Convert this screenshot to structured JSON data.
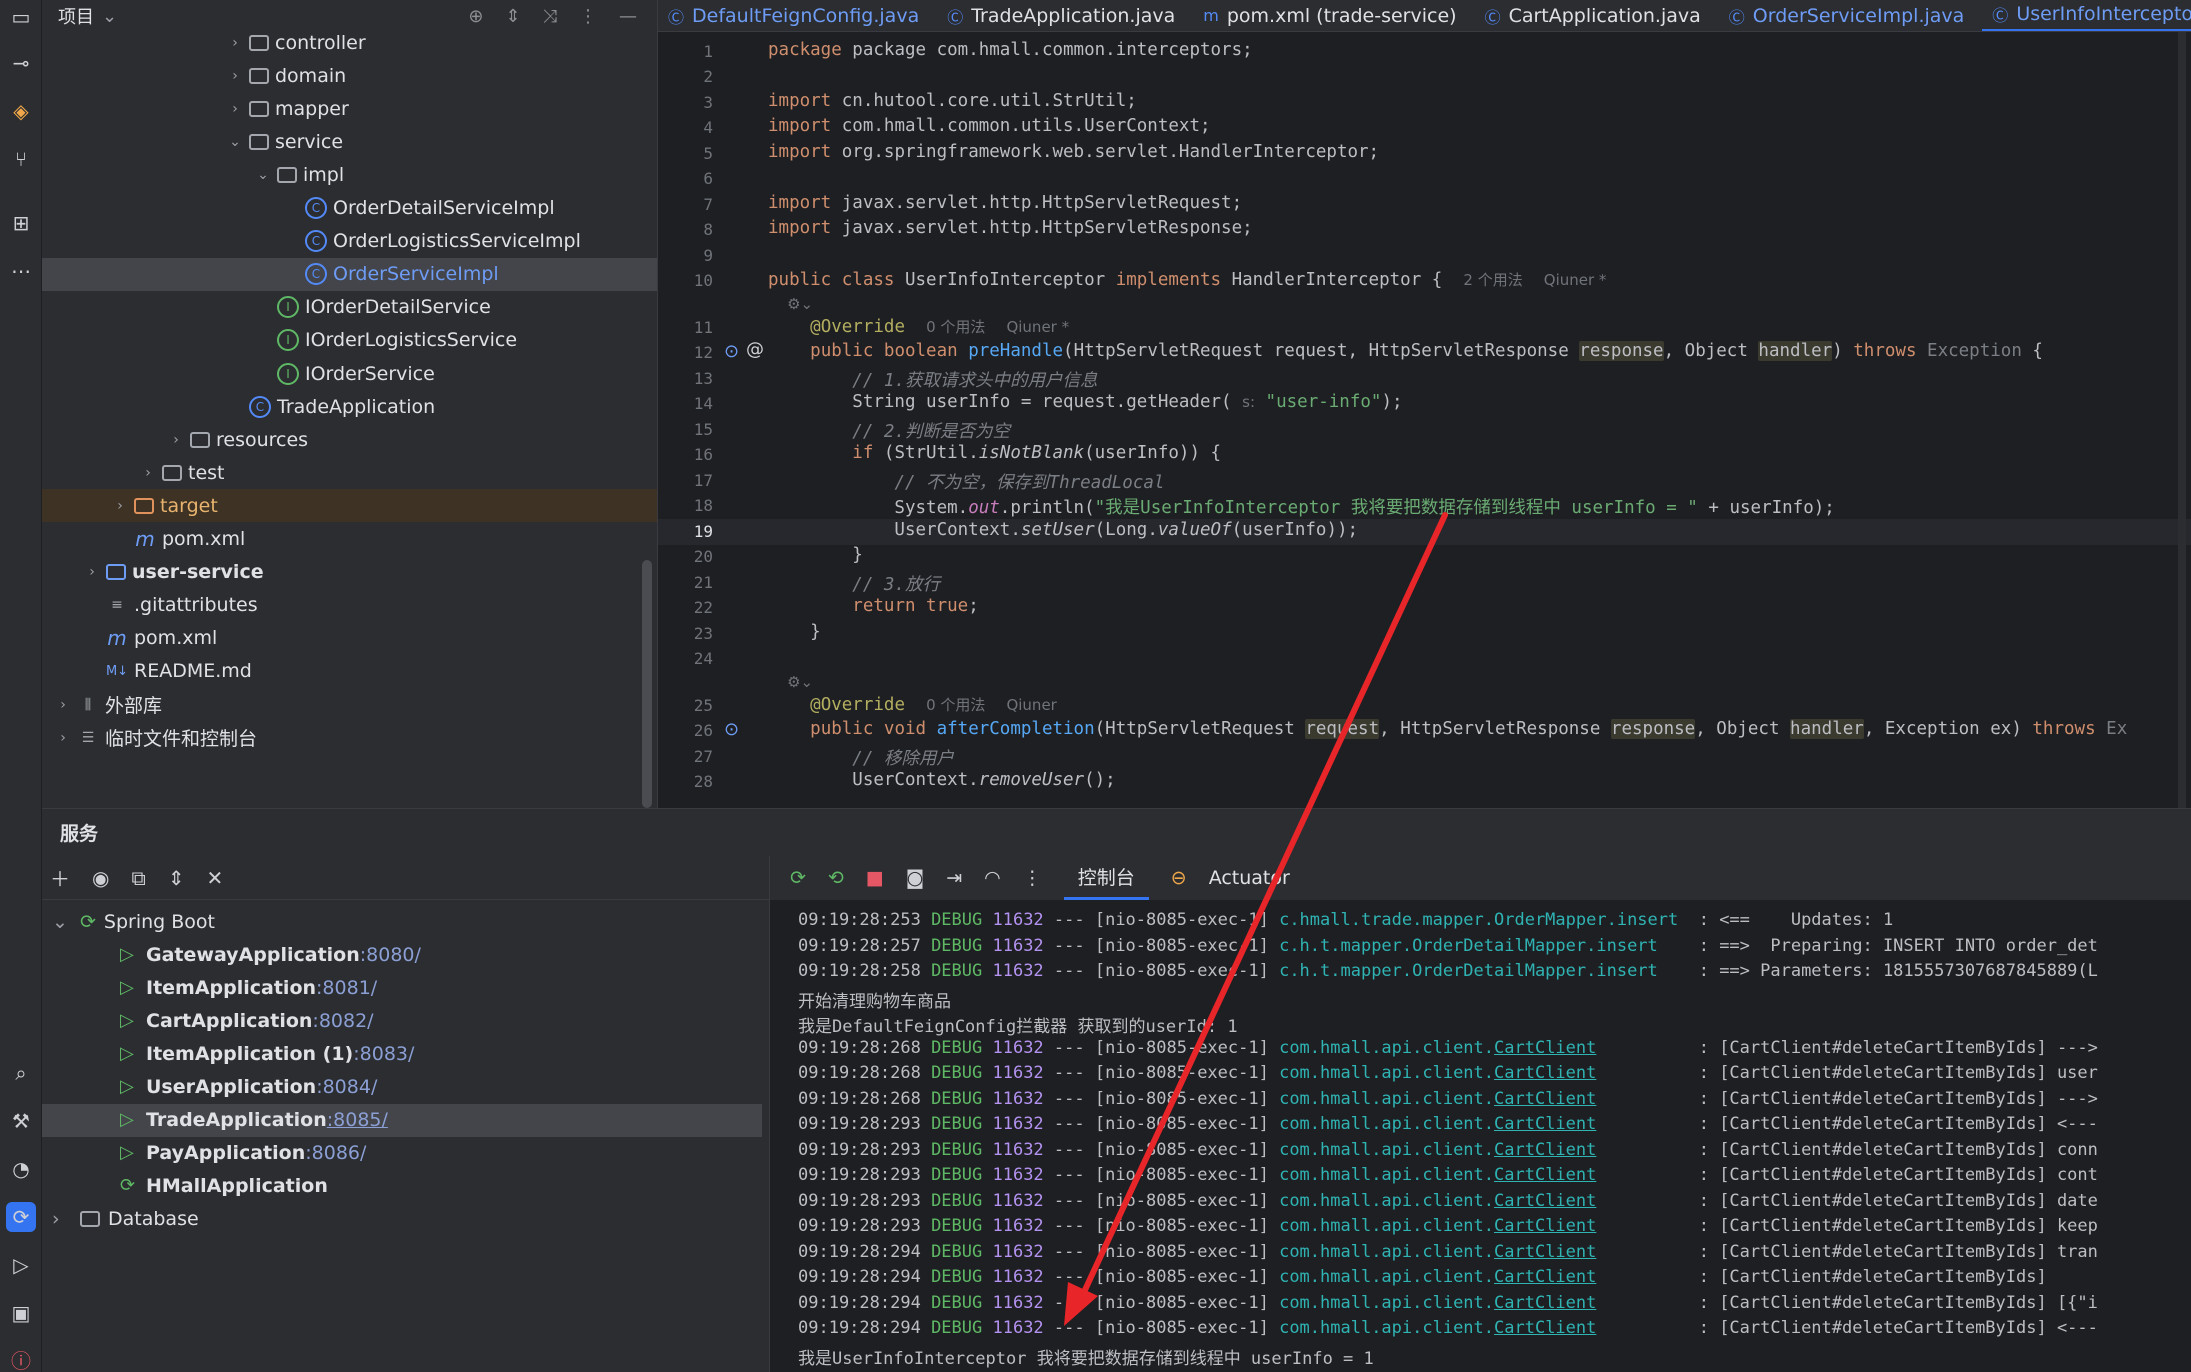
{
  "project": {
    "title": "项目",
    "tree": [
      {
        "label": "controller",
        "type": "folder",
        "arrow": "›",
        "indent": 1
      },
      {
        "label": "domain",
        "type": "folder",
        "arrow": "›",
        "indent": 1
      },
      {
        "label": "mapper",
        "type": "folder",
        "arrow": "›",
        "indent": 1
      },
      {
        "label": "service",
        "type": "folder",
        "arrow": "⌄",
        "indent": 1
      },
      {
        "label": "impl",
        "type": "folder",
        "arrow": "⌄",
        "indent": 2
      },
      {
        "label": "OrderDetailServiceImpl",
        "type": "class",
        "arrow": "",
        "indent": 3
      },
      {
        "label": "OrderLogisticsServiceImpl",
        "type": "class",
        "arrow": "",
        "indent": 3
      },
      {
        "label": "OrderServiceImpl",
        "type": "class",
        "arrow": "",
        "indent": 3,
        "selected": true
      },
      {
        "label": "IOrderDetailService",
        "type": "interface",
        "arrow": "",
        "indent": 2
      },
      {
        "label": "IOrderLogisticsService",
        "type": "interface",
        "arrow": "",
        "indent": 2
      },
      {
        "label": "IOrderService",
        "type": "interface",
        "arrow": "",
        "indent": 2
      },
      {
        "label": "TradeApplication",
        "type": "app",
        "arrow": "",
        "indent": 1
      },
      {
        "label": "resources",
        "type": "folder",
        "arrow": "›",
        "indent": 0
      },
      {
        "label": "test",
        "type": "folder",
        "arrow": "›",
        "indent": -1
      },
      {
        "label": "target",
        "type": "folder-orange",
        "arrow": "›",
        "indent": -2,
        "highlight": true
      },
      {
        "label": "pom.xml",
        "type": "maven",
        "arrow": "",
        "indent": -2
      },
      {
        "label": "user-service",
        "type": "module",
        "arrow": "›",
        "indent": -3,
        "bold": true
      },
      {
        "label": ".gitattributes",
        "type": "file",
        "arrow": "",
        "indent": -3
      },
      {
        "label": "pom.xml",
        "type": "maven",
        "arrow": "",
        "indent": -3
      },
      {
        "label": "README.md",
        "type": "md",
        "arrow": "",
        "indent": -3
      },
      {
        "label": "外部库",
        "type": "lib",
        "arrow": "›",
        "indent": -4
      },
      {
        "label": "临时文件和控制台",
        "type": "scratch",
        "arrow": "›",
        "indent": -4
      }
    ]
  },
  "tabs": [
    {
      "label": "DefaultFeignConfig.java",
      "style": "blue"
    },
    {
      "label": "TradeApplication.java",
      "style": "normal"
    },
    {
      "label": "pom.xml (trade-service)",
      "style": "normal"
    },
    {
      "label": "CartApplication.java",
      "style": "normal"
    },
    {
      "label": "OrderServiceImpl.java",
      "style": "blue"
    },
    {
      "label": "UserInfoInterceptor.java",
      "style": "active"
    }
  ],
  "gutter_numbers": [
    "1",
    "2",
    "3",
    "4",
    "5",
    "6",
    "7",
    "8",
    "9",
    "10",
    "11",
    "12",
    "13",
    "14",
    "15",
    "16",
    "17",
    "18",
    "19",
    "20",
    "21",
    "22",
    "23",
    "24",
    "25",
    "26",
    "27",
    "28"
  ],
  "code": {
    "pkg": "package com.hmall.common.interceptors;",
    "imp1": "cn.hutool.core.util.StrUtil;",
    "imp2": "com.hmall.common.utils.UserContext;",
    "imp3": "org.springframework.web.servlet.HandlerInterceptor;",
    "imp4": "javax.servlet.http.HttpServletRequest;",
    "imp5": "javax.servlet.http.HttpServletResponse;",
    "cls_hint": "2 个用法",
    "author": "Qiuner *",
    "author2": "Qiuner",
    "override": "@Override",
    "usage0": "0 个用法",
    "comment1": "// 1.获取请求头中的用户信息",
    "getheader_str": "\"user-info\"",
    "comment2": "// 2.判断是否为空",
    "comment3": "// 不为空，保存到ThreadLocal",
    "println_str": "\"我是UserInfoInterceptor 我将要把数据存储到线程中 userInfo = \"",
    "comment4": "// 3.放行",
    "comment5": "// 移除用户"
  },
  "services": {
    "title": "服务",
    "root": "Spring Boot",
    "apps": [
      {
        "name": "GatewayApplication",
        "port": ":8080/"
      },
      {
        "name": "ItemApplication",
        "port": ":8081/"
      },
      {
        "name": "CartApplication",
        "port": ":8082/"
      },
      {
        "name": "ItemApplication (1)",
        "port": ":8083/"
      },
      {
        "name": "UserApplication",
        "port": ":8084/"
      },
      {
        "name": "TradeApplication",
        "port": ":8085/",
        "selected": true
      },
      {
        "name": "PayApplication",
        "port": ":8086/"
      },
      {
        "name": "HMallApplication",
        "port": ""
      }
    ],
    "database": "Database"
  },
  "console": {
    "tab_console": "控制台",
    "tab_actuator": "Actuator",
    "lines": [
      {
        "t": "09:19:28:253",
        "lvl": "DEBUG",
        "pid": "11632",
        "th": "--- [nio-8085-exec-1]",
        "logger": "c.hmall.trade.mapper.OrderMapper.insert",
        "u": false,
        "msg": "  : <==    Updates: 1"
      },
      {
        "t": "09:19:28:257",
        "lvl": "DEBUG",
        "pid": "11632",
        "th": "--- [nio-8085-exec-1]",
        "logger": "c.h.t.mapper.OrderDetailMapper.insert",
        "u": false,
        "msg": "    : ==>  Preparing: INSERT INTO order_det"
      },
      {
        "t": "09:19:28:258",
        "lvl": "DEBUG",
        "pid": "11632",
        "th": "--- [nio-8085-exec-1]",
        "logger": "c.h.t.mapper.OrderDetailMapper.insert",
        "u": false,
        "msg": "    : ==> Parameters: 1815557307687845889(L"
      },
      {
        "plain": "开始清理购物车商品"
      },
      {
        "plain": "我是DefaultFeignConfig拦截器 获取到的userId: 1"
      },
      {
        "t": "09:19:28:268",
        "lvl": "DEBUG",
        "pid": "11632",
        "th": "--- [nio-8085-exec-1]",
        "logger": "com.hmall.api.client.CartClient",
        "u": true,
        "msg": "          : [CartClient#deleteCartItemByIds] --->"
      },
      {
        "t": "09:19:28:268",
        "lvl": "DEBUG",
        "pid": "11632",
        "th": "--- [nio-8085-exec-1]",
        "logger": "com.hmall.api.client.CartClient",
        "u": true,
        "msg": "          : [CartClient#deleteCartItemByIds] user"
      },
      {
        "t": "09:19:28:268",
        "lvl": "DEBUG",
        "pid": "11632",
        "th": "--- [nio-8085-exec-1]",
        "logger": "com.hmall.api.client.CartClient",
        "u": true,
        "msg": "          : [CartClient#deleteCartItemByIds] --->"
      },
      {
        "t": "09:19:28:293",
        "lvl": "DEBUG",
        "pid": "11632",
        "th": "--- [nio-8085-exec-1]",
        "logger": "com.hmall.api.client.CartClient",
        "u": true,
        "msg": "          : [CartClient#deleteCartItemByIds] <---"
      },
      {
        "t": "09:19:28:293",
        "lvl": "DEBUG",
        "pid": "11632",
        "th": "--- [nio-8085-exec-1]",
        "logger": "com.hmall.api.client.CartClient",
        "u": true,
        "msg": "          : [CartClient#deleteCartItemByIds] conn"
      },
      {
        "t": "09:19:28:293",
        "lvl": "DEBUG",
        "pid": "11632",
        "th": "--- [nio-8085-exec-1]",
        "logger": "com.hmall.api.client.CartClient",
        "u": true,
        "msg": "          : [CartClient#deleteCartItemByIds] cont"
      },
      {
        "t": "09:19:28:293",
        "lvl": "DEBUG",
        "pid": "11632",
        "th": "--- [nio-8085-exec-1]",
        "logger": "com.hmall.api.client.CartClient",
        "u": true,
        "msg": "          : [CartClient#deleteCartItemByIds] date"
      },
      {
        "t": "09:19:28:293",
        "lvl": "DEBUG",
        "pid": "11632",
        "th": "--- [nio-8085-exec-1]",
        "logger": "com.hmall.api.client.CartClient",
        "u": true,
        "msg": "          : [CartClient#deleteCartItemByIds] keep"
      },
      {
        "t": "09:19:28:294",
        "lvl": "DEBUG",
        "pid": "11632",
        "th": "--- [nio-8085-exec-1]",
        "logger": "com.hmall.api.client.CartClient",
        "u": true,
        "msg": "          : [CartClient#deleteCartItemByIds] tran"
      },
      {
        "t": "09:19:28:294",
        "lvl": "DEBUG",
        "pid": "11632",
        "th": "--- [nio-8085-exec-1]",
        "logger": "com.hmall.api.client.CartClient",
        "u": true,
        "msg": "          : [CartClient#deleteCartItemByIds]"
      },
      {
        "t": "09:19:28:294",
        "lvl": "DEBUG",
        "pid": "11632",
        "th": "--- [nio-8085-exec-1]",
        "logger": "com.hmall.api.client.CartClient",
        "u": true,
        "msg": "          : [CartClient#deleteCartItemByIds] [{\"i"
      },
      {
        "t": "09:19:28:294",
        "lvl": "DEBUG",
        "pid": "11632",
        "th": "--- [nio-8085-exec-1]",
        "logger": "com.hmall.api.client.CartClient",
        "u": true,
        "msg": "          : [CartClient#deleteCartItemByIds] <---"
      },
      {
        "plain": "我是UserInfoInterceptor 我将要把数据存储到线程中 userInfo = 1"
      }
    ]
  },
  "colors": {
    "accent": "#3574f0",
    "annotation_arrow": "#e8262a"
  }
}
